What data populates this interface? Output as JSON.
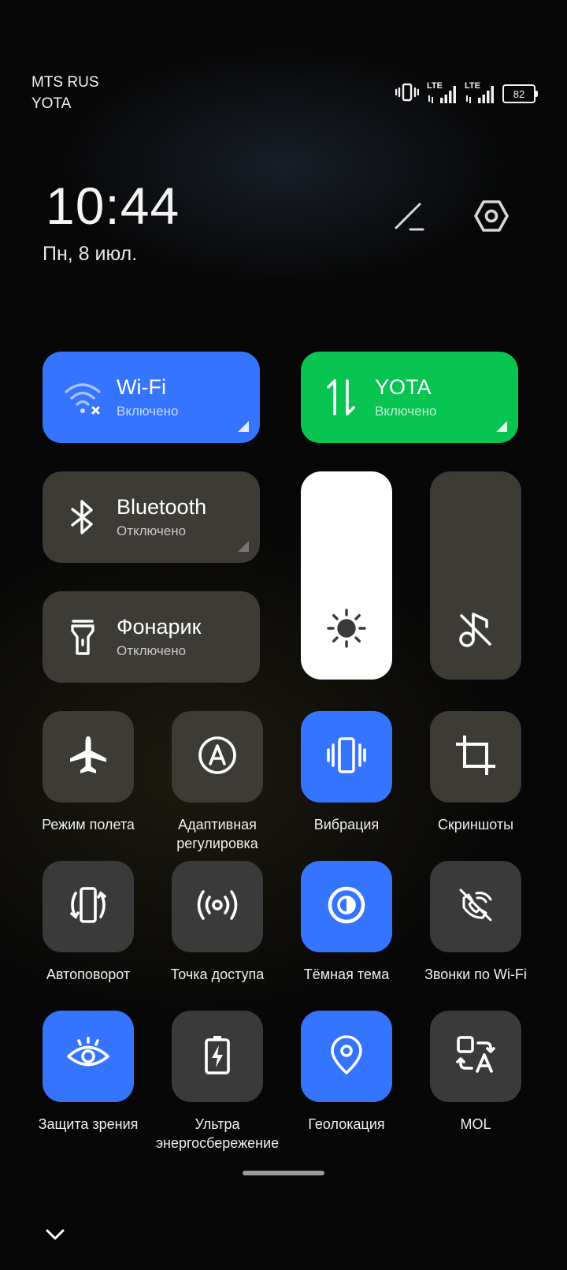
{
  "status_bar": {
    "carrier_1": "MTS RUS",
    "carrier_2": "YOTA",
    "network_1": "LTE",
    "network_2": "LTE",
    "battery_level": "82",
    "icons": [
      "vibrate-icon",
      "signal-lte-icon",
      "signal-lte-icon",
      "battery-icon"
    ]
  },
  "header": {
    "time": "10:44",
    "date": "Пн, 8 июл.",
    "edit_icon": "edit-pencil-icon",
    "settings_icon": "settings-gear-icon"
  },
  "wide_tiles": [
    {
      "title": "Wi-Fi",
      "subtitle": "Включено",
      "state": "on",
      "color": "#3574ff",
      "icon": "wifi-icon"
    },
    {
      "title": "YOTA",
      "subtitle": "Включено",
      "state": "on",
      "color": "#08c450",
      "icon": "mobile-data-icon"
    },
    {
      "title": "Bluetooth",
      "subtitle": "Отключено",
      "state": "off",
      "color": "#3a3a3a",
      "icon": "bluetooth-icon"
    },
    {
      "title": "Фонарик",
      "subtitle": "Отключено",
      "state": "off",
      "color": "#3a3a3a",
      "icon": "flashlight-icon"
    }
  ],
  "sliders": [
    {
      "name": "brightness",
      "icon": "sun-icon",
      "level": 1.0,
      "color": "#ffffff"
    },
    {
      "name": "volume",
      "icon": "music-muted-icon",
      "level": 0.0,
      "color": "#3a3a3a"
    }
  ],
  "quick_toggles": [
    {
      "label": "Режим полета",
      "state": "off",
      "icon": "airplane-icon"
    },
    {
      "label": "Адаптивная регулировка",
      "state": "off",
      "icon": "auto-brightness-icon"
    },
    {
      "label": "Вибрация",
      "state": "on",
      "icon": "vibrate-icon"
    },
    {
      "label": "Скриншоты",
      "state": "off",
      "icon": "crop-icon"
    },
    {
      "label": "Автоповорот",
      "state": "off",
      "icon": "auto-rotate-icon"
    },
    {
      "label": "Точка доступа",
      "state": "off",
      "icon": "hotspot-icon"
    },
    {
      "label": "Тёмная тема",
      "state": "on",
      "icon": "dark-theme-icon"
    },
    {
      "label": "Звонки по Wi-Fi",
      "state": "off",
      "icon": "wifi-calling-icon"
    },
    {
      "label": "Защита зрения",
      "state": "on",
      "icon": "eye-icon"
    },
    {
      "label": "Ультра энергосбережение",
      "state": "off",
      "icon": "battery-saver-icon"
    },
    {
      "label": "Геолокация",
      "state": "on",
      "icon": "location-icon"
    },
    {
      "label": "MOL",
      "state": "off",
      "icon": "translate-icon"
    }
  ],
  "colors": {
    "accent_blue": "#3574ff",
    "accent_green": "#08c450",
    "tile_gray": "#3a3a3a",
    "background": "#070707"
  },
  "footer": {
    "collapse_icon": "chevron-down-icon"
  }
}
